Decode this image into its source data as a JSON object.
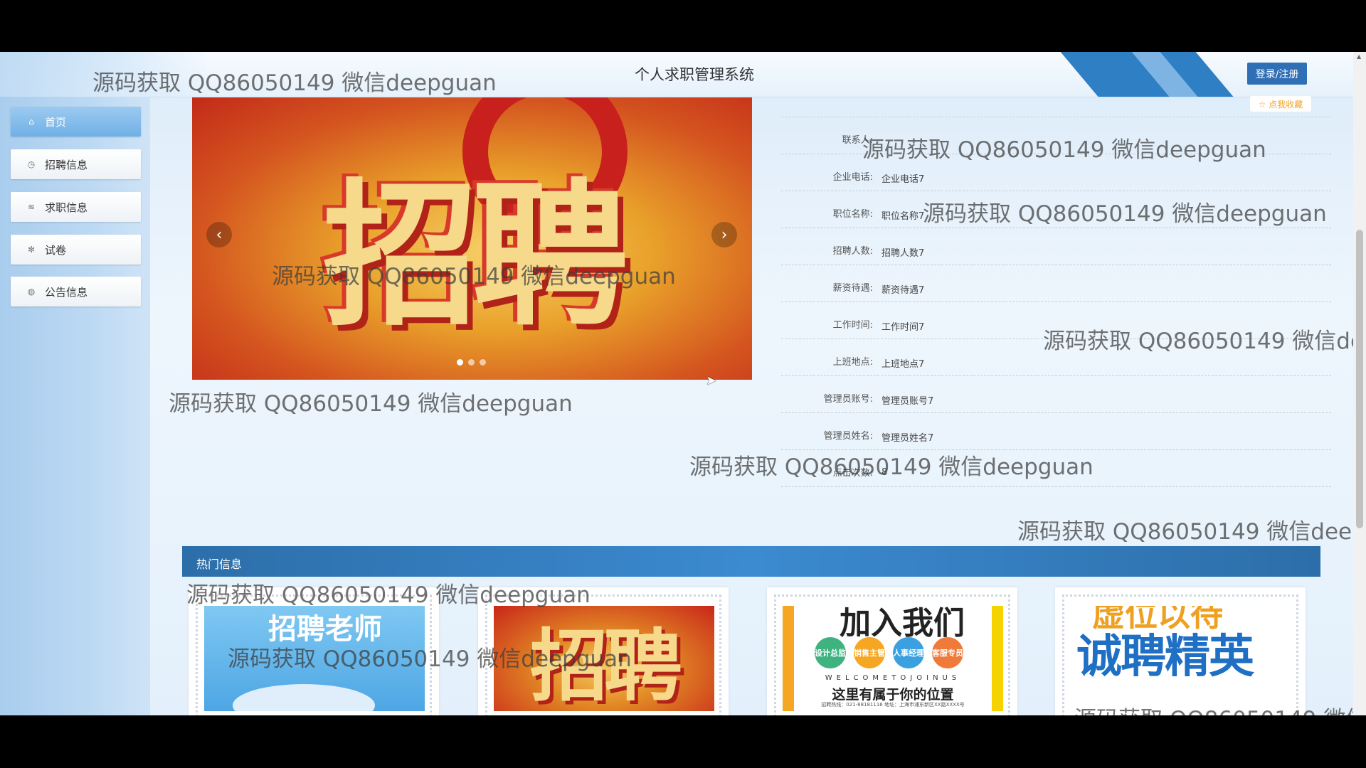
{
  "header": {
    "title": "个人求职管理系统",
    "login_label": "登录/注册"
  },
  "sidebar": {
    "items": [
      {
        "label": "首页",
        "icon": "home-icon",
        "active": true
      },
      {
        "label": "招聘信息",
        "icon": "clock-icon",
        "active": false
      },
      {
        "label": "求职信息",
        "icon": "layers-icon",
        "active": false
      },
      {
        "label": "试卷",
        "icon": "asterisk-icon",
        "active": false
      },
      {
        "label": "公告信息",
        "icon": "globe-icon",
        "active": false
      }
    ]
  },
  "carousel": {
    "image_text": "招聘"
  },
  "detail": {
    "favorite_label": "☆ 点我收藏",
    "rows": [
      {
        "label": "联系人:",
        "value": ""
      },
      {
        "label": "企业电话:",
        "value": "企业电话7"
      },
      {
        "label": "职位名称:",
        "value": "职位名称7"
      },
      {
        "label": "招聘人数:",
        "value": "招聘人数7"
      },
      {
        "label": "薪资待遇:",
        "value": "薪资待遇7"
      },
      {
        "label": "工作时间:",
        "value": "工作时间7"
      },
      {
        "label": "上班地点:",
        "value": "上班地点7"
      },
      {
        "label": "管理员账号:",
        "value": "管理员账号7"
      },
      {
        "label": "管理员姓名:",
        "value": "管理员姓名7"
      },
      {
        "label": "点击次数:",
        "value": "8"
      }
    ]
  },
  "hot": {
    "title": "热门信息",
    "cards": [
      {
        "title": "招聘老师"
      },
      {
        "title": "招聘"
      },
      {
        "heading": "加入我们",
        "circles": [
          "设计总监",
          "销售主管",
          "人事经理",
          "客服专员"
        ],
        "welcome": "WELCOMETOJOINUS",
        "slogan": "这里有属于你的位置",
        "tel": "招聘热线：021-88181116 地址：上海市浦东新区XX路XXXX号"
      },
      {
        "line1": "虚位以待",
        "line2": "诚聘精英"
      }
    ]
  },
  "watermark": "源码获取 QQ86050149 微信deepguan",
  "colors": {
    "header_button": "#2f6fb6",
    "hot_bar": "#2c6ea9",
    "favorite": "#f0a32c"
  }
}
